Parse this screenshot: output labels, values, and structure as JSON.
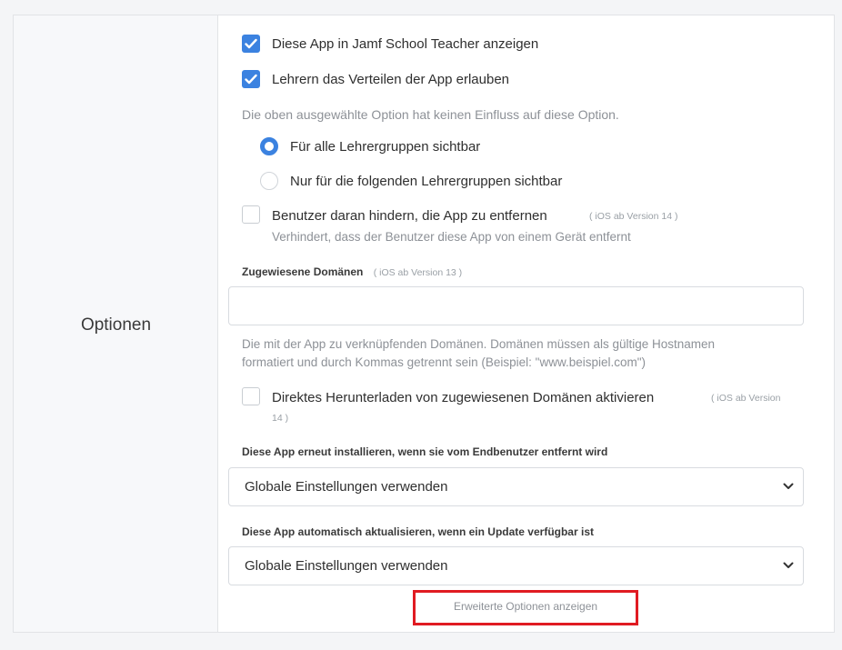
{
  "section": {
    "title": "Optionen"
  },
  "teacher": {
    "show_app_label": "Diese App in Jamf School Teacher anzeigen",
    "show_app_checked": true,
    "allow_distribute_label": "Lehrern das Verteilen der App erlauben",
    "allow_distribute_checked": true,
    "hint": "Die oben ausgewählte Option hat keinen Einfluss auf diese Option.",
    "visibility_options": [
      {
        "label": "Für alle Lehrergruppen sichtbar",
        "selected": true
      },
      {
        "label": "Nur für die folgenden Lehrergruppen sichtbar",
        "selected": false
      }
    ]
  },
  "prevent_removal": {
    "label": "Benutzer daran hindern, die App zu entfernen",
    "badge": "( iOS ab Version 14 )",
    "description": "Verhindert, dass der Benutzer diese App von einem Gerät entfernt",
    "checked": false
  },
  "domains": {
    "label": "Zugewiesene Domänen",
    "badge": "( iOS ab Version 13 )",
    "value": "",
    "hint_line1": "Die mit der App zu verknüpfenden Domänen. Domänen müssen als gültige Hostnamen",
    "hint_line2": "formatiert und durch Kommas getrennt sein (Beispiel: \"www.beispiel.com\")"
  },
  "direct_download": {
    "label": "Direktes Herunterladen von zugewiesenen Domänen aktivieren",
    "badge_line1": "( iOS ab Version",
    "badge_line2": "14 )",
    "checked": false
  },
  "reinstall": {
    "label": "Diese App erneut installieren, wenn sie vom Endbenutzer entfernt wird",
    "selected": "Globale Einstellungen verwenden"
  },
  "auto_update": {
    "label": "Diese App automatisch aktualisieren, wenn ein Update verfügbar ist",
    "selected": "Globale Einstellungen verwenden"
  },
  "advanced": {
    "link_label": "Erweiterte Optionen anzeigen"
  },
  "colors": {
    "accent": "#3b82e0",
    "highlight": "#e01b22"
  }
}
